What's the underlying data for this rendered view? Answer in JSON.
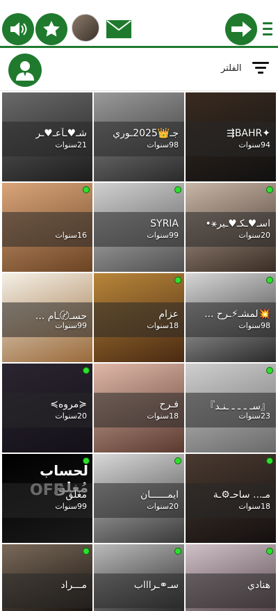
{
  "topbar": {
    "icons": [
      "speaker-icon",
      "star-icon",
      "avatar",
      "mail-icon",
      "arrow-right-icon",
      "menu-icon"
    ],
    "accent_color": "#1f7a2e"
  },
  "filterbar": {
    "filter_label": "الفلتر"
  },
  "users": [
    {
      "name": "شـ♥ـآعـ♥ـر",
      "age": "21سنوات",
      "online": false,
      "photo": "linear-gradient(160deg,#6a6a6a,#1d1d1d)"
    },
    {
      "name": "جـ👑2025ـوري",
      "age": "98سنوات",
      "online": false,
      "photo": "linear-gradient(160deg,#9a9a9a,#2a2a2a)"
    },
    {
      "name": "✦BAHR⇶",
      "age": "94سنوات",
      "online": false,
      "photo": "linear-gradient(160deg,#3a2b20,#111111)"
    },
    {
      "name": "",
      "age": "16سنوات",
      "online": true,
      "photo": "linear-gradient(160deg,#d9a57a,#6b4424)"
    },
    {
      "name": "SYRIA",
      "age": "99سنوات",
      "online": true,
      "photo": "linear-gradient(160deg,#d0d0d0,#505050)"
    },
    {
      "name": "اسـ♥ـكـ♥ـير⚹•",
      "age": "20سنوات",
      "online": true,
      "photo": "linear-gradient(160deg,#c8b6a6,#3a2c24)"
    },
    {
      "name": "حسـ〄ـام ...",
      "age": "99سنوات",
      "online": false,
      "photo": "linear-gradient(160deg,#f4f0e6,#9a6a3a)"
    },
    {
      "name": "عزام",
      "age": "18سنوات",
      "online": true,
      "photo": "linear-gradient(160deg,#b8863a,#4a2a12)"
    },
    {
      "name": "💥لمشـ⚡ـرح ...",
      "age": "98سنوات",
      "online": true,
      "photo": "linear-gradient(160deg,#d6d6d6,#2a2a2a)"
    },
    {
      "name": "≼مروه≽",
      "age": "20سنوات",
      "online": true,
      "photo": "linear-gradient(160deg,#2a2530,#141018)"
    },
    {
      "name": "فـرح",
      "age": "18سنوات",
      "online": false,
      "photo": "linear-gradient(160deg,#e0b8a8,#5a3a30)"
    },
    {
      "name": "『سـ ـ ـ ـ ـنـد』",
      "age": "23سنوات",
      "online": true,
      "photo": "linear-gradient(160deg,#cfcfcf,#6a6a6a)"
    },
    {
      "name": "مغلق",
      "age": "99سنوات",
      "online": true,
      "photo": "linear-gradient(160deg,#000000,#1a1a1a)"
    },
    {
      "name": "ايمــــــان",
      "age": "20سنوات",
      "online": true,
      "photo": "linear-gradient(160deg,#d8d8d8,#3a3a3a)"
    },
    {
      "name": "مـ... ساحـ⚙ـة",
      "age": "18سنوات",
      "online": true,
      "photo": "linear-gradient(160deg,#4a3a30,#141010)"
    },
    {
      "name": "مـــراد",
      "age": "",
      "online": true,
      "photo": "linear-gradient(160deg,#7a6a5a,#1a1410)"
    },
    {
      "name": "سـ⚭ـراااب",
      "age": "",
      "online": true,
      "photo": "linear-gradient(160deg,#bbbbbb,#2a2a2a)"
    },
    {
      "name": "هنادي",
      "age": "",
      "online": true,
      "photo": "linear-gradient(160deg,#d0c0c8,#5a4a50)"
    }
  ],
  "closed_text": "لحساب مُغلق",
  "closed_off": "OFF"
}
